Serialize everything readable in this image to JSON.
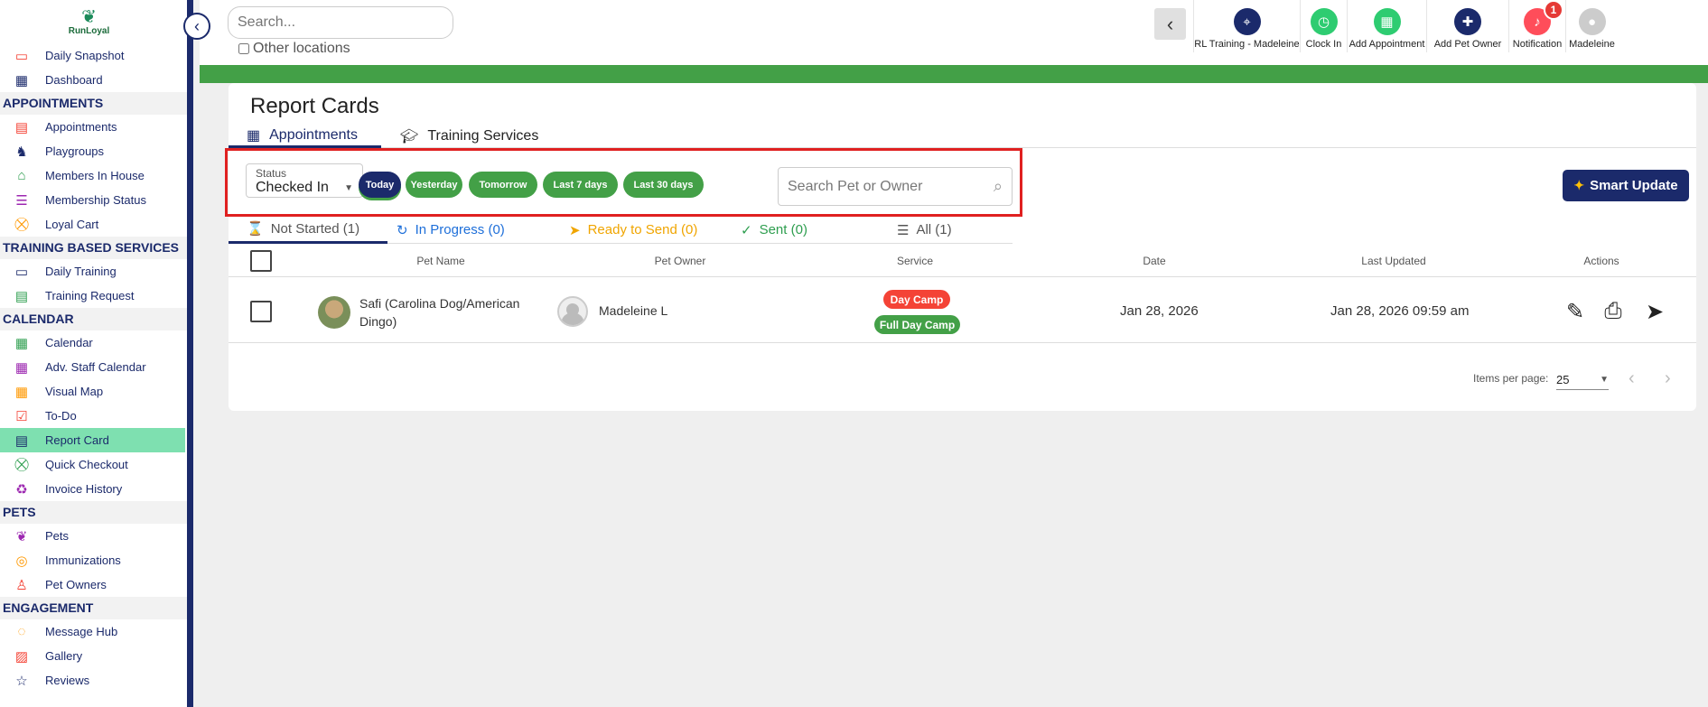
{
  "sidebar": {
    "brand": "RunLoyal",
    "top_items": [
      {
        "label": "Daily Snapshot",
        "icon": "today-icon"
      },
      {
        "label": "Dashboard",
        "icon": "dashboard-icon"
      }
    ],
    "sections": [
      {
        "title": "APPOINTMENTS",
        "items": [
          "Appointments",
          "Playgroups",
          "Members In House",
          "Membership Status",
          "Loyal Cart"
        ]
      },
      {
        "title": "TRAINING BASED SERVICES",
        "items": [
          "Daily Training",
          "Training Request"
        ]
      },
      {
        "title": "CALENDAR",
        "items": [
          "Calendar",
          "Adv. Staff Calendar",
          "Visual Map",
          "To-Do",
          "Report Card",
          "Quick Checkout",
          "Invoice History"
        ]
      },
      {
        "title": "PETS",
        "items": [
          "Pets",
          "Immunizations",
          "Pet Owners"
        ]
      },
      {
        "title": "ENGAGEMENT",
        "items": [
          "Message Hub",
          "Gallery",
          "Reviews"
        ]
      }
    ],
    "active_item": "Report Card"
  },
  "topbar": {
    "search_placeholder": "Search...",
    "other_locations": "Other locations",
    "actions": [
      {
        "label": "RL Training - Madeleine",
        "icon": "location-icon",
        "color": "#1b2a6b"
      },
      {
        "label": "Clock In",
        "icon": "clock-icon",
        "color": "#2ecc71"
      },
      {
        "label": "Add Appointment",
        "icon": "calendar-add-icon",
        "color": "#2ecc71"
      },
      {
        "label": "Add Pet Owner",
        "icon": "add-user-icon",
        "color": "#1b2a6b"
      },
      {
        "label": "Notification",
        "icon": "bell-icon",
        "color": "#ff4d5a",
        "badge": "1"
      },
      {
        "label": "Madeleine",
        "icon": "avatar-icon",
        "color": "#cccccc"
      }
    ]
  },
  "page": {
    "title": "Report Cards",
    "tabs": [
      "Appointments",
      "Training Services"
    ],
    "status_label": "Status",
    "status_value": "Checked In",
    "date_chips": [
      "Today",
      "Yesterday",
      "Tomorrow",
      "Last 7 days",
      "Last 30 days"
    ],
    "search_placeholder": "Search Pet or Owner",
    "smart_update": "Smart Update",
    "sub_tabs": [
      {
        "label": "Not Started (1)",
        "color": "#555555"
      },
      {
        "label": "In Progress (0)",
        "color": "#1e6fd9"
      },
      {
        "label": "Ready to Send (0)",
        "color": "#f0a500"
      },
      {
        "label": "Sent (0)",
        "color": "#2e9e4f"
      },
      {
        "label": "All (1)",
        "color": "#555555"
      }
    ],
    "columns": [
      "Pet Name",
      "Pet Owner",
      "Service",
      "Date",
      "Last Updated",
      "Actions"
    ],
    "rows": [
      {
        "pet_name": "Safi (Carolina Dog/American Dingo)",
        "owner": "Madeleine L",
        "services": [
          {
            "label": "Day Camp",
            "color": "#f44336"
          },
          {
            "label": "Full Day Camp",
            "color": "#43a047"
          }
        ],
        "date": "Jan 28, 2026",
        "last_updated": "Jan 28, 2026 09:59 am"
      }
    ],
    "items_per_page_label": "Items per page:",
    "items_per_page": "25"
  }
}
